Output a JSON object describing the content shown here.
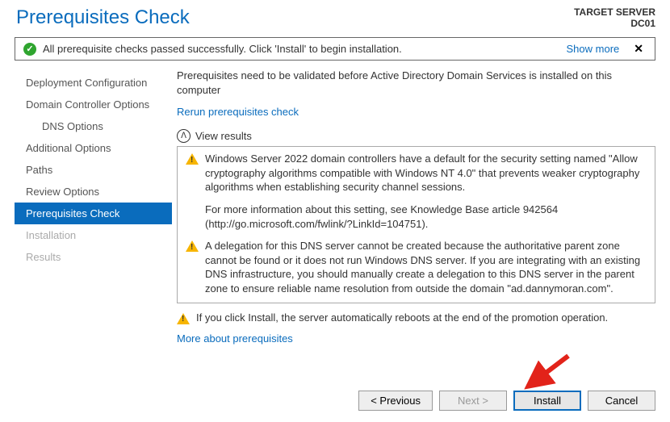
{
  "header": {
    "title": "Prerequisites Check",
    "target_label": "TARGET SERVER",
    "target_name": "DC01"
  },
  "status": {
    "message": "All prerequisite checks passed successfully.  Click 'Install' to begin installation.",
    "show_more": "Show more"
  },
  "sidebar": {
    "items": [
      {
        "label": "Deployment Configuration",
        "state": "normal"
      },
      {
        "label": "Domain Controller Options",
        "state": "normal"
      },
      {
        "label": "DNS Options",
        "state": "indent"
      },
      {
        "label": "Additional Options",
        "state": "normal"
      },
      {
        "label": "Paths",
        "state": "normal"
      },
      {
        "label": "Review Options",
        "state": "normal"
      },
      {
        "label": "Prerequisites Check",
        "state": "active"
      },
      {
        "label": "Installation",
        "state": "disabled"
      },
      {
        "label": "Results",
        "state": "disabled"
      }
    ]
  },
  "main": {
    "intro": "Prerequisites need to be validated before Active Directory Domain Services is installed on this computer",
    "rerun_link": "Rerun prerequisites check",
    "view_results": "View results",
    "warnings": [
      {
        "text": "Windows Server 2022 domain controllers have a default for the security setting named \"Allow cryptography algorithms compatible with Windows NT 4.0\" that prevents weaker cryptography algorithms when establishing security channel sessions.",
        "extra": "For more information about this setting, see Knowledge Base article 942564 (http://go.microsoft.com/fwlink/?LinkId=104751)."
      },
      {
        "text": "A delegation for this DNS server cannot be created because the authoritative parent zone cannot be found or it does not run Windows DNS server. If you are integrating with an existing DNS infrastructure, you should manually create a delegation to this DNS server in the parent zone to ensure reliable name resolution from outside the domain \"ad.dannymoran.com\". Otherwise, no action is required."
      }
    ],
    "footer_warning": "If you click Install, the server automatically reboots at the end of the promotion operation.",
    "more_link": "More about prerequisites"
  },
  "buttons": {
    "previous": "< Previous",
    "next": "Next >",
    "install": "Install",
    "cancel": "Cancel"
  }
}
